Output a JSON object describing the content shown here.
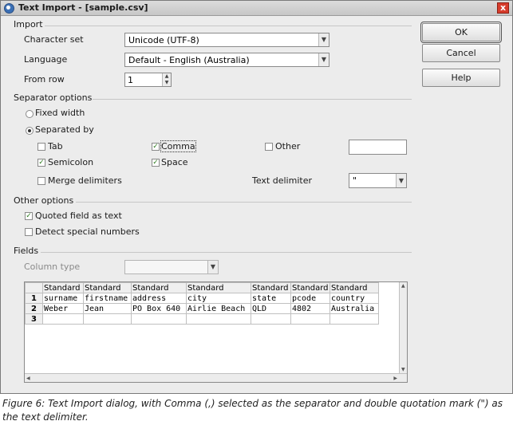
{
  "window": {
    "title": "Text Import - [sample.csv]",
    "close_glyph": "x"
  },
  "import": {
    "section_label": "Import",
    "character_set": {
      "label": "Character set",
      "value": "Unicode (UTF-8)"
    },
    "language": {
      "label": "Language",
      "value": "Default - English (Australia)"
    },
    "from_row": {
      "label": "From row",
      "value": "1"
    }
  },
  "separator_options": {
    "section_label": "Separator options",
    "fixed_width": {
      "label": "Fixed width",
      "selected": false
    },
    "separated_by": {
      "label": "Separated by",
      "selected": true
    },
    "tab": {
      "label": "Tab",
      "checked": false
    },
    "comma": {
      "label": "Comma",
      "checked": true
    },
    "other": {
      "label": "Other",
      "checked": false,
      "value": ""
    },
    "semicolon": {
      "label": "Semicolon",
      "checked": true
    },
    "space": {
      "label": "Space",
      "checked": true
    },
    "merge_delimiters": {
      "label": "Merge delimiters",
      "checked": false
    },
    "text_delimiter": {
      "label": "Text delimiter",
      "value": "\""
    }
  },
  "other_options": {
    "section_label": "Other options",
    "quoted_field_as_text": {
      "label": "Quoted field as text",
      "checked": true
    },
    "detect_special_numbers": {
      "label": "Detect special numbers",
      "checked": false
    }
  },
  "fields": {
    "section_label": "Fields",
    "column_type": {
      "label": "Column type",
      "value": ""
    },
    "grid": {
      "headers": [
        "Standard",
        "Standard",
        "Standard",
        "Standard",
        "Standard",
        "Standard",
        "Standard"
      ],
      "rows": [
        {
          "num": "1",
          "cells": [
            "surname",
            "firstname",
            "address",
            "city",
            "state",
            "pcode",
            "country"
          ]
        },
        {
          "num": "2",
          "cells": [
            "Weber",
            "Jean",
            "PO Box 640",
            "Airlie Beach",
            "QLD",
            "4802",
            "Australia"
          ]
        },
        {
          "num": "3",
          "cells": [
            "",
            "",
            "",
            "",
            "",
            "",
            ""
          ]
        }
      ]
    }
  },
  "buttons": {
    "ok": "OK",
    "cancel": "Cancel",
    "help": "Help"
  },
  "caption": "Figure 6: Text Import dialog, with Comma (,) selected as the separator and double quotation mark (\") as the text delimiter.",
  "colors": {
    "check_mark": "#2d7a1e",
    "title_close": "#d63c2c"
  }
}
